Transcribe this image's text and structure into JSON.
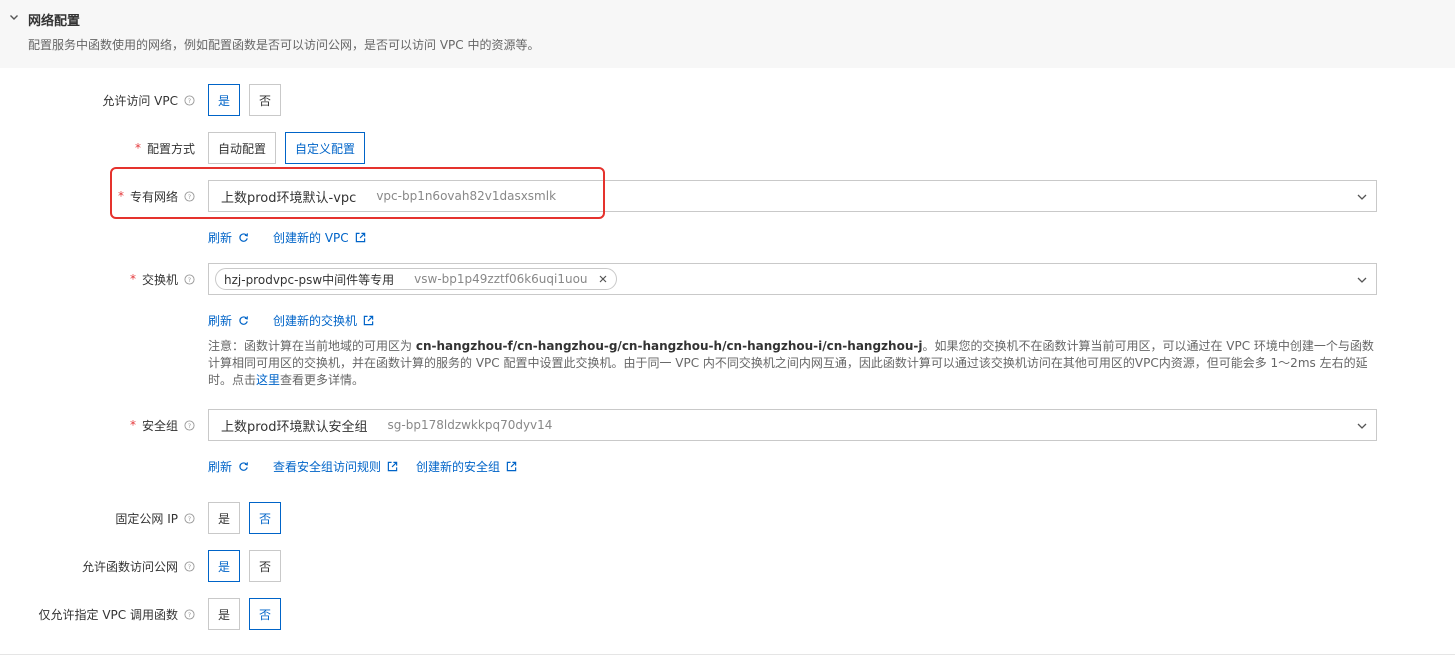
{
  "section": {
    "title": "网络配置",
    "description": "配置服务中函数使用的网络，例如配置函数是否可以访问公网，是否可以访问 VPC 中的资源等。"
  },
  "allow_vpc": {
    "label": "允许访问 VPC",
    "options": [
      "是",
      "否"
    ],
    "selected": "是"
  },
  "config_mode": {
    "label": "配置方式",
    "options": [
      "自动配置",
      "自定义配置"
    ],
    "selected": "自定义配置"
  },
  "vpc": {
    "label": "专有网络",
    "value_name": "上数prod环境默认-vpc",
    "value_id": "vpc-bp1n6ovah82v1dasxsmlk",
    "refresh": "刷新",
    "create": "创建新的 VPC"
  },
  "vswitch": {
    "label": "交换机",
    "tag_name": "hzj-prodvpc-psw中间件等专用",
    "tag_id": "vsw-bp1p49zztf06k6uqi1uou",
    "refresh": "刷新",
    "create": "创建新的交换机"
  },
  "note": {
    "prefix": "注意：函数计算在当前地域的可用区为 ",
    "zones": "cn-hangzhou-f/cn-hangzhou-g/cn-hangzhou-h/cn-hangzhou-i/cn-hangzhou-j",
    "middle": "。如果您的交换机不在函数计算当前可用区，可以通过在 VPC 环境中创建一个与函数计算相同可用区的交换机，并在函数计算的服务的 VPC 配置中设置此交换机。由于同一 VPC 内不同交换机之间内网互通，因此函数计算可以通过该交换机访问在其他可用区的VPC内资源，但可能会多 1～2ms 左右的延时。点击",
    "link": "这里",
    "suffix": "查看更多详情。"
  },
  "security_group": {
    "label": "安全组",
    "value_name": "上数prod环境默认安全组",
    "value_id": "sg-bp178ldzwkkpq70dyv14",
    "refresh": "刷新",
    "view_rules": "查看安全组访问规则",
    "create": "创建新的安全组"
  },
  "fixed_ip": {
    "label": "固定公网 IP",
    "options": [
      "是",
      "否"
    ],
    "selected": "否"
  },
  "allow_internet": {
    "label": "允许函数访问公网",
    "options": [
      "是",
      "否"
    ],
    "selected": "是"
  },
  "only_vpc_invoke": {
    "label": "仅允许指定 VPC 调用函数",
    "options": [
      "是",
      "否"
    ],
    "selected": "否"
  },
  "required_mark": "*",
  "colors": {
    "accent": "#0064c8",
    "required": "#e4393c",
    "highlight": "#e5322d"
  },
  "icons": {
    "help": "help-circle-icon",
    "refresh": "refresh-icon",
    "external": "external-link-icon",
    "chevron": "chevron-down-icon",
    "close": "close-icon"
  }
}
